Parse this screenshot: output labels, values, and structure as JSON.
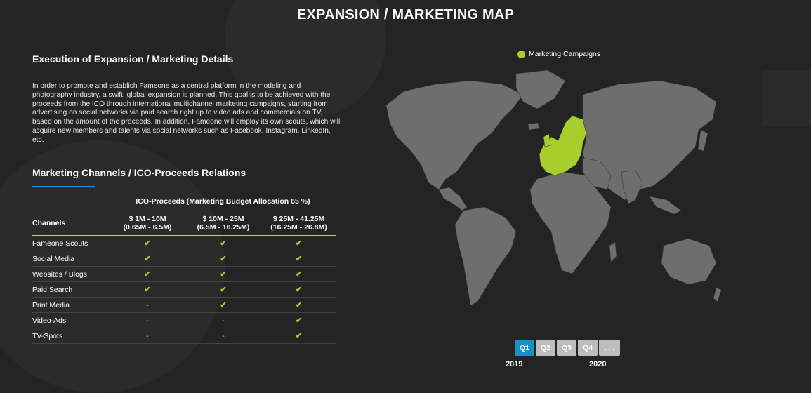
{
  "page": {
    "title": "EXPANSION / MARKETING MAP"
  },
  "execution": {
    "heading": "Execution of Expansion / Marketing Details",
    "body": "In order to promote and establish Fameone as a central platform in the modeling and photography industry, a swift, global expansion is planned. This goal is to be achieved with the proceeds from the ICO through international multichannel marketing campaigns, starting from advertising on social networks via paid search right up to video ads and commercials on TV, based on the amount of the proceeds. In addition, Fameone will employ its own scouts, which will acquire new members and talents via social networks such as Facebook, Instagram, LinkedIn, etc."
  },
  "channels": {
    "heading": "Marketing Channels / ICO-Proceeds Relations",
    "caption": "ICO-Proceeds (Marketing Budget Allocation 65 %)",
    "col_channels": "Channels",
    "columns": [
      {
        "line1": "$ 1M - 10M",
        "line2": "(0.65M - 6.5M)"
      },
      {
        "line1": "$ 10M - 25M",
        "line2": "(6.5M - 16.25M)"
      },
      {
        "line1": "$ 25M - 41.25M",
        "line2": "(16.25M - 26.8M)"
      }
    ],
    "check_symbol": "✔",
    "dash_symbol": "-",
    "rows": [
      {
        "name": "Fameone Scouts",
        "values": [
          "✔",
          "✔",
          "✔"
        ]
      },
      {
        "name": "Social Media",
        "values": [
          "✔",
          "✔",
          "✔"
        ]
      },
      {
        "name": "Websites / Blogs",
        "values": [
          "✔",
          "✔",
          "✔"
        ]
      },
      {
        "name": "Paid Search",
        "values": [
          "✔",
          "✔",
          "✔"
        ]
      },
      {
        "name": "Print Media",
        "values": [
          "-",
          "✔",
          "✔"
        ]
      },
      {
        "name": "Video-Ads",
        "values": [
          "-",
          "-",
          "✔"
        ]
      },
      {
        "name": "TV-Spots",
        "values": [
          "-",
          "-",
          "✔"
        ]
      }
    ]
  },
  "map": {
    "legend_label": "Marketing Campaigns",
    "land_color": "#6e6e6e",
    "highlight_color": "#a6cf2e",
    "highlighted_region": "Europe"
  },
  "timeline": {
    "quarters": [
      "Q1",
      "Q2",
      "Q3",
      "Q4",
      ". . ."
    ],
    "active": "Q1",
    "year_start": "2019",
    "year_end": "2020"
  },
  "colors": {
    "background": "#242424",
    "accent_blue": "#1a90c8",
    "accent_green": "#a6cf2e"
  }
}
